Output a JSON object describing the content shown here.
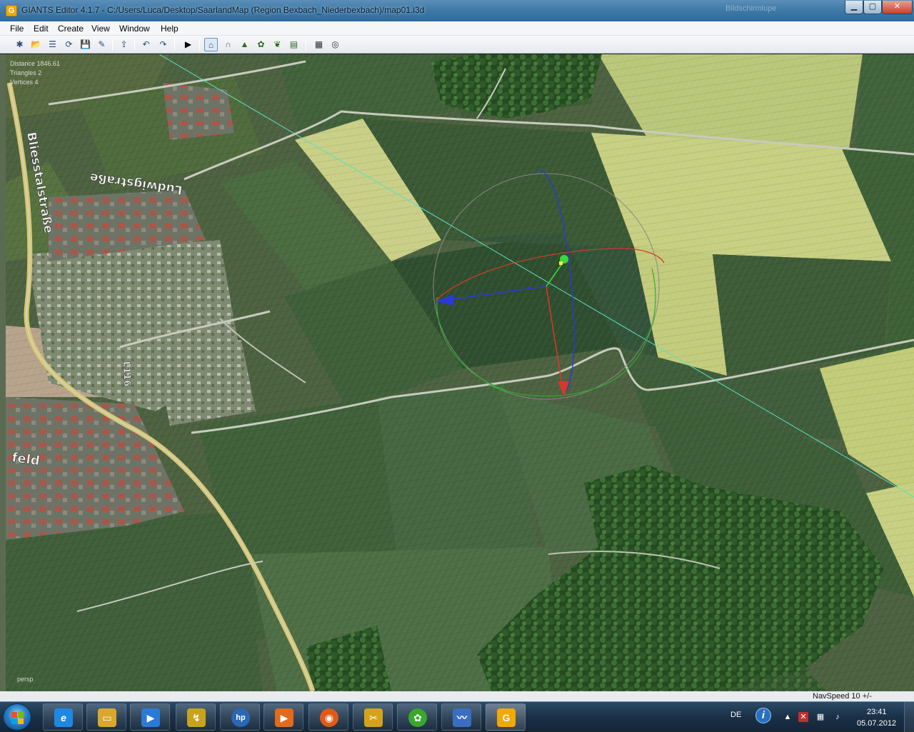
{
  "window": {
    "title": "GIANTS Editor 4.1.7 - C:/Users/Luca/Desktop/SaarlandMap (Region Bexbach_Niederbexbach)/map01.i3d",
    "app_icon_letter": "G",
    "ghost_text": "Bildschirmlupe",
    "controls": {
      "minimize": "▁",
      "maximize": "▢",
      "close": "✕"
    }
  },
  "menu": {
    "items": [
      "File",
      "Edit",
      "Create",
      "View",
      "Window",
      "Help"
    ]
  },
  "toolbar": {
    "buttons": [
      {
        "name": "new-icon",
        "glyph": "✱"
      },
      {
        "name": "open-icon",
        "glyph": "📂"
      },
      {
        "name": "properties-icon",
        "glyph": "☰"
      },
      {
        "name": "refresh-icon",
        "glyph": "⟳"
      },
      {
        "name": "save-icon",
        "glyph": "💾"
      },
      {
        "name": "save-as-icon",
        "glyph": "✎"
      },
      {
        "name": "import-icon",
        "glyph": "⇪"
      },
      {
        "name": "undo-icon",
        "glyph": "↶"
      },
      {
        "name": "redo-icon",
        "glyph": "↷"
      },
      {
        "name": "play-icon",
        "glyph": "▶"
      },
      {
        "name": "select-mode-icon",
        "glyph": "⌂"
      },
      {
        "name": "move-mode-icon",
        "glyph": "∩"
      },
      {
        "name": "terrain-sculpt-icon",
        "glyph": "▲"
      },
      {
        "name": "terrain-paint-icon",
        "glyph": "✿"
      },
      {
        "name": "foliage-paint-icon",
        "glyph": "❦"
      },
      {
        "name": "terrain-detail-icon",
        "glyph": "▤"
      },
      {
        "name": "grid-icon",
        "glyph": "▦"
      },
      {
        "name": "snap-icon",
        "glyph": "◎"
      }
    ]
  },
  "viewport": {
    "stats": [
      "Distance 1846.61",
      "Triangles 2",
      "Vertices 4"
    ],
    "camera_label": "persp",
    "road_labels": [
      "Bliesstalstraße",
      "Ludwigstraße",
      "L116",
      "feld"
    ]
  },
  "status": {
    "navspeed": "NavSpeed 10 +/-"
  },
  "taskbar": {
    "apps": [
      {
        "name": "internet-explorer",
        "letter": "e",
        "color": "#1e88e5"
      },
      {
        "name": "file-explorer",
        "letter": "▭",
        "color": "#d9a72c"
      },
      {
        "name": "windows-media",
        "letter": "▶",
        "color": "#2b7bd6"
      },
      {
        "name": "install-tool",
        "letter": "↯",
        "color": "#c9a31b"
      },
      {
        "name": "hp-support",
        "letter": "hp",
        "color": "#2a68b5"
      },
      {
        "name": "media-player",
        "letter": "▶",
        "color": "#e26a1b"
      },
      {
        "name": "firefox",
        "letter": "◉",
        "color": "#e05a1a"
      },
      {
        "name": "tools",
        "letter": "✂",
        "color": "#d4a31a"
      },
      {
        "name": "icq",
        "letter": "✿",
        "color": "#3aa82a"
      },
      {
        "name": "messenger",
        "letter": "〰",
        "color": "#3a6ec0"
      },
      {
        "name": "giants-editor",
        "letter": "G",
        "color": "#f2a900"
      }
    ],
    "tray": {
      "language": "DE",
      "info": "i",
      "time": "23:41",
      "date": "05.07.2012"
    }
  }
}
